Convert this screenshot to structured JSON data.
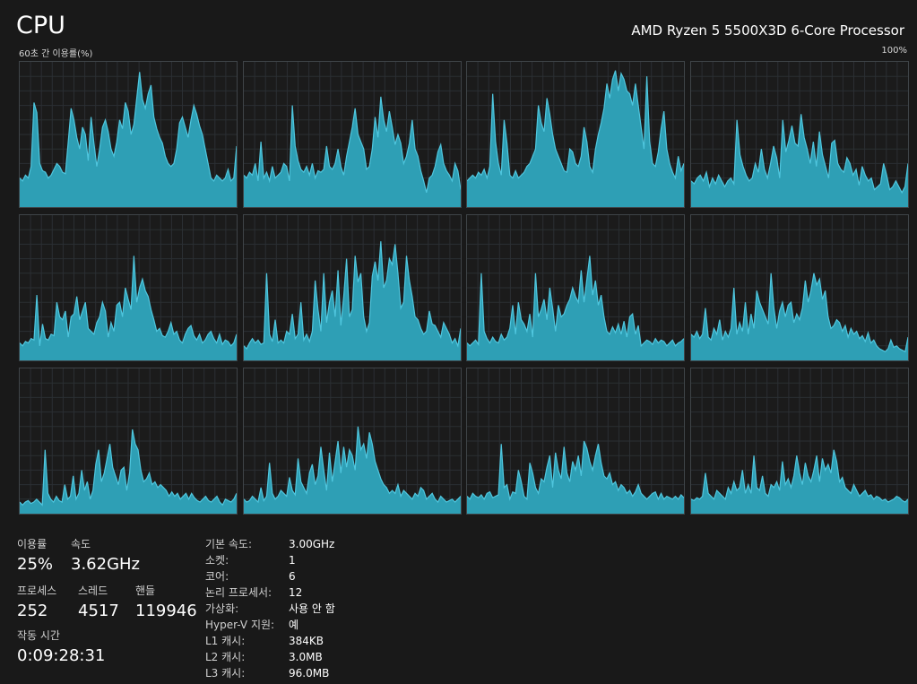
{
  "header": {
    "title": "CPU",
    "processor": "AMD Ryzen 5 5500X3D 6-Core Processor",
    "graph_caption": "60초 간 이용률(%)",
    "graph_max": "100%"
  },
  "colors": {
    "background": "#191919",
    "grid_line": "#2b2f33",
    "border": "#3f4448",
    "fill": "#2e9fb5",
    "stroke": "#4fc6de"
  },
  "chart_data": {
    "type": "area",
    "y_unit": "%",
    "ylim": [
      0,
      100
    ],
    "x_window_seconds": 60,
    "grid": true,
    "series": [
      {
        "values": [
          20,
          18,
          22,
          20,
          28,
          72,
          65,
          30,
          25,
          24,
          20,
          22,
          26,
          30,
          28,
          24,
          23,
          45,
          68,
          60,
          48,
          40,
          55,
          50,
          32,
          62,
          44,
          28,
          40,
          55,
          60,
          52,
          40,
          35,
          45,
          60,
          54,
          72,
          66,
          50,
          57,
          75,
          93,
          74,
          68,
          78,
          84,
          62,
          54,
          48,
          44,
          35,
          30,
          28,
          30,
          40,
          58,
          62,
          55,
          48,
          60,
          70,
          64,
          56,
          50,
          40,
          30,
          20,
          18,
          22,
          20,
          18,
          20,
          26,
          18,
          20,
          42
        ]
      },
      {
        "values": [
          22,
          20,
          24,
          22,
          30,
          18,
          45,
          20,
          24,
          18,
          28,
          20,
          22,
          24,
          30,
          28,
          18,
          70,
          42,
          32,
          26,
          24,
          28,
          22,
          30,
          20,
          25,
          24,
          26,
          42,
          28,
          26,
          30,
          40,
          28,
          22,
          35,
          45,
          55,
          68,
          50,
          45,
          40,
          26,
          28,
          40,
          62,
          48,
          76,
          60,
          52,
          66,
          55,
          43,
          50,
          44,
          30,
          35,
          44,
          60,
          40,
          35,
          25,
          18,
          10,
          20,
          22,
          28,
          38,
          43,
          30,
          25,
          22,
          18,
          30,
          25,
          12
        ]
      },
      {
        "values": [
          18,
          20,
          22,
          20,
          24,
          22,
          26,
          20,
          28,
          78,
          45,
          30,
          22,
          60,
          44,
          22,
          20,
          25,
          20,
          22,
          24,
          28,
          30,
          35,
          40,
          70,
          58,
          52,
          75,
          64,
          50,
          40,
          35,
          30,
          25,
          24,
          40,
          38,
          30,
          28,
          35,
          55,
          45,
          28,
          24,
          40,
          50,
          58,
          68,
          85,
          75,
          88,
          94,
          80,
          92,
          88,
          80,
          78,
          70,
          85,
          70,
          55,
          40,
          90,
          45,
          30,
          28,
          38,
          54,
          66,
          40,
          30,
          24,
          20,
          35,
          25,
          30
        ]
      },
      {
        "values": [
          18,
          16,
          20,
          22,
          18,
          24,
          14,
          20,
          16,
          22,
          18,
          14,
          18,
          20,
          16,
          60,
          36,
          28,
          22,
          18,
          20,
          30,
          24,
          40,
          26,
          20,
          30,
          42,
          34,
          20,
          60,
          38,
          46,
          56,
          44,
          42,
          64,
          48,
          40,
          30,
          45,
          28,
          52,
          36,
          28,
          20,
          44,
          46,
          30,
          26,
          24,
          34,
          30,
          22,
          26,
          15,
          28,
          22,
          18,
          20,
          12,
          14,
          16,
          30,
          22,
          12,
          14,
          18,
          14,
          10,
          14,
          30
        ]
      },
      {
        "values": [
          12,
          10,
          13,
          12,
          15,
          14,
          45,
          10,
          25,
          15,
          14,
          18,
          17,
          40,
          30,
          28,
          34,
          16,
          30,
          32,
          44,
          28,
          34,
          40,
          22,
          20,
          18,
          26,
          30,
          40,
          34,
          16,
          26,
          20,
          38,
          40,
          30,
          50,
          42,
          35,
          72,
          40,
          50,
          56,
          48,
          44,
          35,
          28,
          20,
          22,
          17,
          16,
          20,
          26,
          18,
          20,
          14,
          12,
          18,
          22,
          24,
          17,
          14,
          18,
          12,
          14,
          18,
          20,
          15,
          12,
          18,
          11,
          14,
          13,
          10,
          12,
          18
        ]
      },
      {
        "values": [
          10,
          8,
          12,
          15,
          12,
          14,
          11,
          12,
          60,
          18,
          13,
          28,
          12,
          14,
          12,
          20,
          18,
          32,
          15,
          18,
          40,
          14,
          18,
          13,
          20,
          55,
          35,
          20,
          60,
          26,
          40,
          48,
          30,
          62,
          24,
          44,
          70,
          30,
          35,
          72,
          54,
          60,
          30,
          20,
          26,
          58,
          68,
          55,
          82,
          50,
          55,
          70,
          66,
          80,
          60,
          36,
          40,
          72,
          55,
          44,
          30,
          28,
          22,
          18,
          20,
          34,
          25,
          24,
          20,
          16,
          26,
          22,
          18,
          12,
          15,
          10,
          22
        ]
      },
      {
        "values": [
          12,
          10,
          12,
          14,
          11,
          60,
          20,
          15,
          12,
          16,
          13,
          12,
          18,
          14,
          16,
          22,
          38,
          18,
          40,
          28,
          25,
          20,
          32,
          16,
          60,
          30,
          35,
          42,
          28,
          50,
          36,
          20,
          38,
          30,
          32,
          38,
          42,
          50,
          44,
          40,
          62,
          40,
          56,
          72,
          45,
          55,
          38,
          45,
          30,
          20,
          18,
          23,
          19,
          25,
          18,
          27,
          16,
          30,
          32,
          18,
          24,
          10,
          12,
          14,
          13,
          11,
          15,
          12,
          14,
          13,
          10,
          12,
          14,
          10,
          12,
          13,
          15
        ]
      },
      {
        "values": [
          18,
          16,
          20,
          15,
          18,
          36,
          16,
          14,
          22,
          18,
          28,
          14,
          20,
          16,
          22,
          50,
          18,
          26,
          20,
          40,
          18,
          32,
          22,
          48,
          40,
          35,
          30,
          25,
          60,
          36,
          22,
          34,
          40,
          30,
          38,
          40,
          26,
          32,
          28,
          36,
          55,
          40,
          48,
          60,
          52,
          56,
          42,
          48,
          30,
          22,
          24,
          28,
          26,
          20,
          24,
          16,
          22,
          18,
          20,
          15,
          17,
          13,
          19,
          12,
          14,
          10,
          8,
          7,
          6,
          8,
          14,
          9,
          10,
          8,
          7,
          6,
          16
        ]
      },
      {
        "values": [
          8,
          6,
          8,
          9,
          7,
          8,
          10,
          8,
          6,
          44,
          14,
          10,
          8,
          12,
          9,
          8,
          20,
          10,
          12,
          26,
          10,
          14,
          30,
          16,
          22,
          10,
          16,
          34,
          44,
          22,
          28,
          38,
          48,
          32,
          26,
          20,
          30,
          32,
          16,
          28,
          58,
          48,
          44,
          30,
          22,
          24,
          28,
          20,
          22,
          18,
          20,
          18,
          16,
          12,
          15,
          12,
          14,
          10,
          12,
          14,
          10,
          14,
          11,
          9,
          8,
          10,
          12,
          9,
          8,
          10,
          12,
          8,
          6,
          10,
          9,
          8,
          10,
          14
        ]
      },
      {
        "values": [
          10,
          8,
          9,
          12,
          10,
          8,
          18,
          9,
          12,
          35,
          14,
          10,
          12,
          16,
          14,
          12,
          25,
          16,
          13,
          38,
          22,
          18,
          14,
          28,
          34,
          20,
          26,
          46,
          30,
          16,
          42,
          22,
          36,
          50,
          28,
          46,
          32,
          44,
          40,
          30,
          60,
          44,
          48,
          38,
          56,
          48,
          36,
          30,
          24,
          20,
          18,
          14,
          16,
          14,
          20,
          12,
          16,
          14,
          12,
          10,
          14,
          12,
          18,
          16,
          10,
          12,
          14,
          10,
          8,
          12,
          10,
          8,
          9,
          10,
          8,
          10,
          12
        ]
      },
      {
        "values": [
          12,
          10,
          14,
          12,
          11,
          13,
          10,
          14,
          15,
          11,
          12,
          13,
          48,
          18,
          20,
          10,
          15,
          14,
          30,
          22,
          12,
          10,
          35,
          28,
          18,
          14,
          24,
          22,
          32,
          40,
          18,
          42,
          30,
          24,
          46,
          28,
          22,
          36,
          30,
          40,
          26,
          50,
          45,
          36,
          30,
          40,
          48,
          35,
          26,
          24,
          28,
          20,
          22,
          16,
          20,
          18,
          14,
          16,
          12,
          15,
          20,
          14,
          12,
          10,
          12,
          14,
          15,
          10,
          14,
          10,
          12,
          11,
          10,
          12,
          10,
          13,
          11
        ]
      },
      {
        "values": [
          10,
          9,
          11,
          10,
          12,
          28,
          14,
          12,
          10,
          16,
          14,
          12,
          10,
          18,
          14,
          22,
          16,
          18,
          30,
          14,
          20,
          14,
          40,
          18,
          16,
          26,
          14,
          12,
          20,
          18,
          22,
          16,
          36,
          20,
          24,
          18,
          26,
          40,
          28,
          20,
          35,
          26,
          22,
          30,
          40,
          22,
          38,
          30,
          34,
          28,
          44,
          36,
          22,
          25,
          18,
          16,
          14,
          20,
          16,
          12,
          14,
          16,
          12,
          13,
          10,
          12,
          11,
          9,
          10,
          8,
          9,
          10,
          12,
          11,
          9,
          8,
          10
        ]
      }
    ]
  },
  "stats": {
    "utilization": {
      "label": "이용률",
      "value": "25%"
    },
    "speed": {
      "label": "속도",
      "value": "3.62GHz"
    },
    "processes": {
      "label": "프로세스",
      "value": "252"
    },
    "threads": {
      "label": "스레드",
      "value": "4517"
    },
    "handles": {
      "label": "핸들",
      "value": "119946"
    },
    "uptime": {
      "label": "작동 시간",
      "value": "0:09:28:31"
    }
  },
  "specs": [
    {
      "label": "기본 속도:",
      "value": "3.00GHz"
    },
    {
      "label": "소켓:",
      "value": "1"
    },
    {
      "label": "코어:",
      "value": "6"
    },
    {
      "label": "논리 프로세서:",
      "value": "12"
    },
    {
      "label": "가상화:",
      "value": "사용 안 함"
    },
    {
      "label": "Hyper-V 지원:",
      "value": "예"
    },
    {
      "label": "L1 캐시:",
      "value": "384KB"
    },
    {
      "label": "L2 캐시:",
      "value": "3.0MB"
    },
    {
      "label": "L3 캐시:",
      "value": "96.0MB"
    }
  ]
}
